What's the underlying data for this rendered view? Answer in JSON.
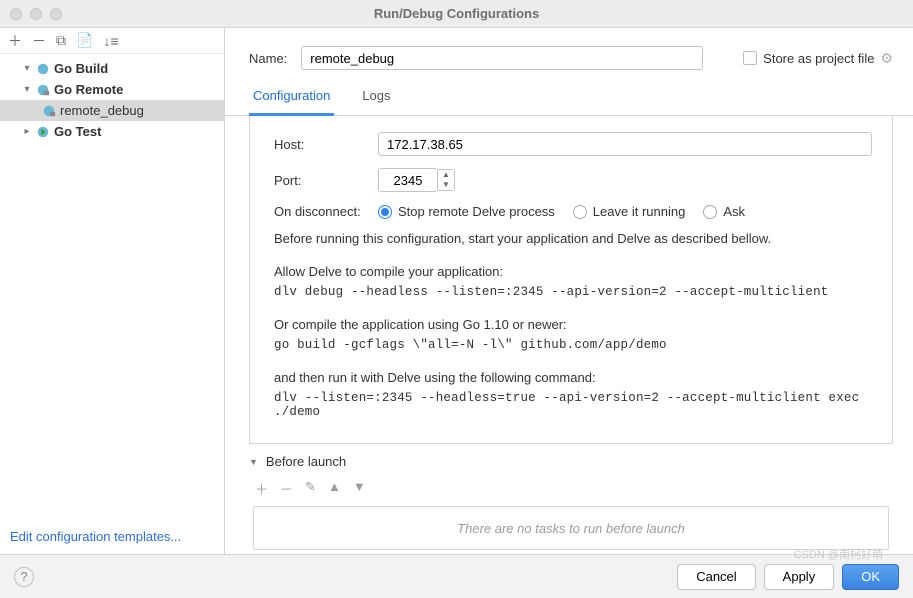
{
  "window": {
    "title": "Run/Debug Configurations"
  },
  "sidebar": {
    "items": [
      {
        "label": "Go Build",
        "expanded": true
      },
      {
        "label": "Go Remote",
        "expanded": true,
        "children": [
          {
            "label": "remote_debug",
            "selected": true
          }
        ]
      },
      {
        "label": "Go Test",
        "expanded": false
      }
    ],
    "edit_templates": "Edit configuration templates..."
  },
  "form": {
    "name_label": "Name:",
    "name_value": "remote_debug",
    "store_label": "Store as project file"
  },
  "tabs": {
    "configuration": "Configuration",
    "logs": "Logs"
  },
  "config": {
    "host_label": "Host:",
    "host_value": "172.17.38.65",
    "port_label": "Port:",
    "port_value": "2345",
    "disconnect_label": "On disconnect:",
    "disconnect_options": {
      "stop": "Stop remote Delve process",
      "leave": "Leave it running",
      "ask": "Ask"
    },
    "info_line": "Before running this configuration, start your application and Delve as described bellow.",
    "allow_text": "Allow Delve to compile your application:",
    "allow_cmd": "dlv debug --headless --listen=:2345 --api-version=2 --accept-multiclient",
    "or_text": "Or compile the application using Go 1.10 or newer:",
    "or_cmd": "go build -gcflags \\\"all=-N -l\\\" github.com/app/demo",
    "then_text": "and then run it with Delve using the following command:",
    "then_cmd": "dlv --listen=:2345 --headless=true --api-version=2 --accept-multiclient exec ./demo"
  },
  "before_launch": {
    "title": "Before launch",
    "empty_text": "There are no tasks to run before launch"
  },
  "footer": {
    "cancel": "Cancel",
    "apply": "Apply",
    "ok": "OK"
  },
  "watermark": "CSDN @南柯好萌"
}
